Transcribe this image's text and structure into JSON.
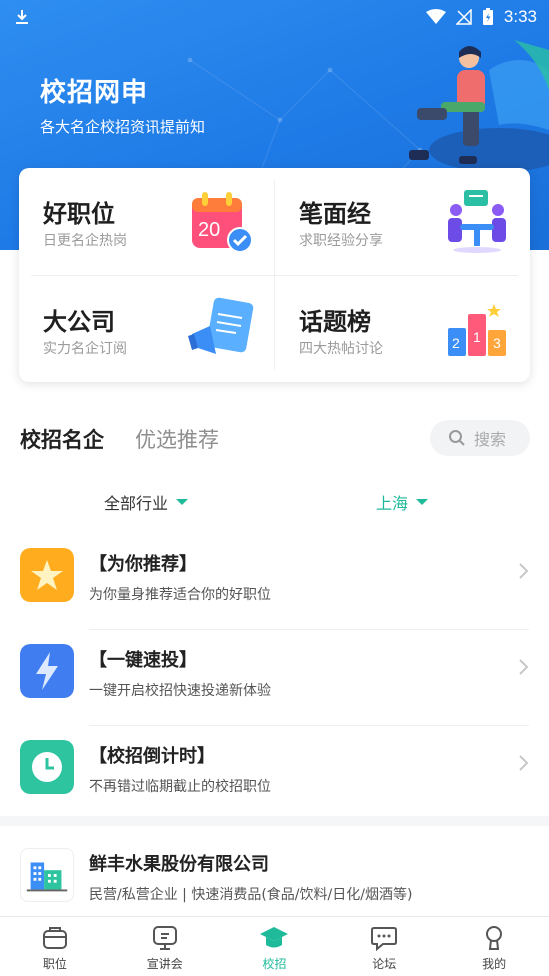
{
  "status_bar": {
    "time": "3:33"
  },
  "banner": {
    "title": "校招网申",
    "subtitle": "各大名企校招资讯提前知"
  },
  "features": [
    {
      "title": "好职位",
      "subtitle": "日更名企热岗",
      "icon": "calendar-check-icon"
    },
    {
      "title": "笔面经",
      "subtitle": "求职经验分享",
      "icon": "interview-icon"
    },
    {
      "title": "大公司",
      "subtitle": "实力名企订阅",
      "icon": "megaphone-icon"
    },
    {
      "title": "话题榜",
      "subtitle": "四大热帖讨论",
      "icon": "podium-icon"
    }
  ],
  "calendar_number": "20",
  "podium_numbers": [
    "2",
    "1",
    "3"
  ],
  "tabs": {
    "active": "校招名企",
    "inactive": "优选推荐"
  },
  "search": {
    "label": "搜索"
  },
  "filters": {
    "industry": "全部行业",
    "city": "上海"
  },
  "list": [
    {
      "title": "【为你推荐】",
      "desc": "为你量身推荐适合你的好职位",
      "icon": "star-icon",
      "color": "#ffb020"
    },
    {
      "title": "【一键速投】",
      "desc": "一键开启校招快速投递新体验",
      "icon": "lightning-icon",
      "color": "#3f7df0"
    },
    {
      "title": "【校招倒计时】",
      "desc": "不再错过临期截止的校招职位",
      "icon": "clock-icon",
      "color": "#2ec4a0"
    }
  ],
  "company": {
    "name": "鲜丰水果股份有限公司",
    "tags": "民营/私营企业 | 快速消费品(食品/饮料/日化/烟酒等)"
  },
  "nav": [
    {
      "label": "职位",
      "icon": "briefcase-icon",
      "active": false
    },
    {
      "label": "宣讲会",
      "icon": "presentation-icon",
      "active": false
    },
    {
      "label": "校招",
      "icon": "graduation-cap-icon",
      "active": true
    },
    {
      "label": "论坛",
      "icon": "chat-icon",
      "active": false
    },
    {
      "label": "我的",
      "icon": "profile-icon",
      "active": false
    }
  ],
  "colors": {
    "primary_blue": "#1e7ae6",
    "accent_green": "#1fba9a"
  }
}
